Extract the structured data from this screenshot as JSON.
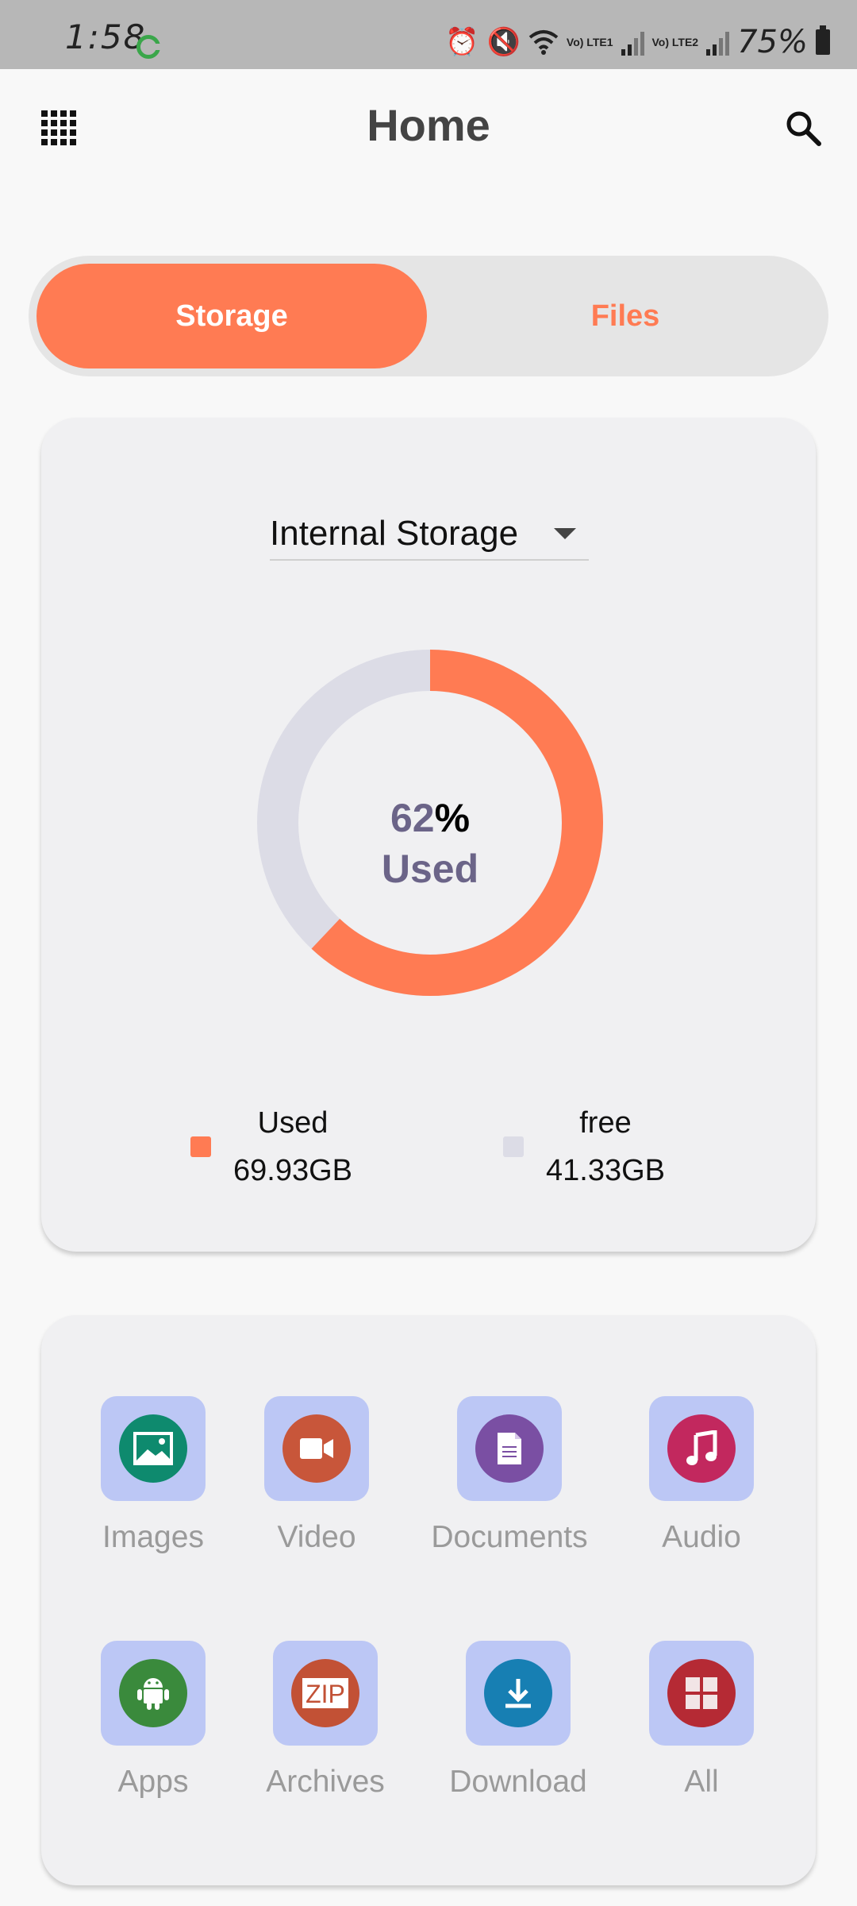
{
  "status_bar": {
    "time": "1:58",
    "net1": "Vo) LTE1",
    "net2": "Vo) LTE2",
    "battery": "75%"
  },
  "header": {
    "title": "Home",
    "menu_icon": "grid-menu-icon",
    "search_icon": "search-icon"
  },
  "toggle": {
    "storage_label": "Storage",
    "files_label": "Files",
    "active": "Storage"
  },
  "storage": {
    "selector_value": "Internal Storage",
    "percent": "62",
    "percent_sign": "%",
    "used_caption": "Used",
    "used_fraction": 0.62,
    "used_label": "Used",
    "used_value": "69.93GB",
    "free_label": "free",
    "free_value": "41.33GB"
  },
  "categories": [
    {
      "label": "Images",
      "icon": "image-icon",
      "color": "#0e8a6e"
    },
    {
      "label": "Video",
      "icon": "video-camera-icon",
      "color": "#c8563a"
    },
    {
      "label": "Documents",
      "icon": "document-icon",
      "color": "#7a4fa3"
    },
    {
      "label": "Audio",
      "icon": "music-note-icon",
      "color": "#c2285e"
    },
    {
      "label": "Apps",
      "icon": "android-icon",
      "color": "#3a8a3c"
    },
    {
      "label": "Archives",
      "icon": "zip-icon",
      "color": "#c25135"
    },
    {
      "label": "Download",
      "icon": "download-icon",
      "color": "#177fb3"
    },
    {
      "label": "All",
      "icon": "all-files-icon",
      "color": "#b52a34"
    }
  ],
  "colors": {
    "accent": "#ff7b53",
    "free": "#dcdce6",
    "tile": "#bcc7f5"
  }
}
